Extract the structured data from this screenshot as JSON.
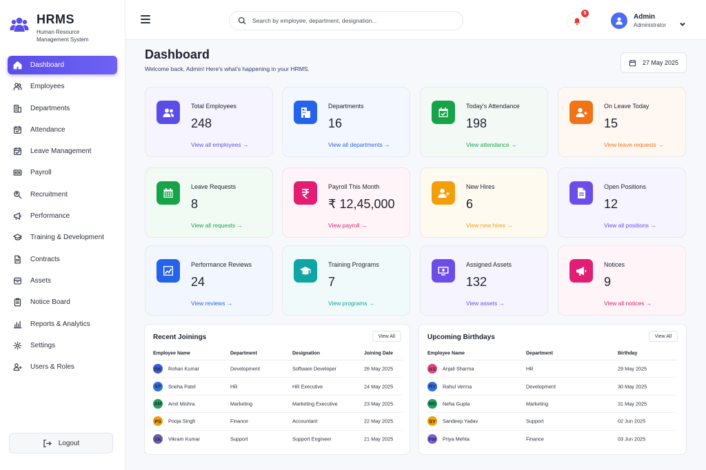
{
  "brand": {
    "title": "HRMS",
    "subtitle": "Human Resource Management System"
  },
  "nav": [
    {
      "label": "Dashboard",
      "icon": "home-icon",
      "active": true
    },
    {
      "label": "Employees",
      "icon": "users-icon"
    },
    {
      "label": "Departments",
      "icon": "building-icon"
    },
    {
      "label": "Attendance",
      "icon": "calendar-check-icon"
    },
    {
      "label": "Leave Management",
      "icon": "calendar-leave-icon"
    },
    {
      "label": "Payroll",
      "icon": "money-icon"
    },
    {
      "label": "Recruitment",
      "icon": "search-person-icon"
    },
    {
      "label": "Performance",
      "icon": "megaphone-icon"
    },
    {
      "label": "Training & Development",
      "icon": "graduation-cap-icon"
    },
    {
      "label": "Contracts",
      "icon": "document-icon"
    },
    {
      "label": "Assets",
      "icon": "box-icon"
    },
    {
      "label": "Notice Board",
      "icon": "clipboard-icon"
    },
    {
      "label": "Reports & Analytics",
      "icon": "bar-chart-icon"
    },
    {
      "label": "Settings",
      "icon": "gear-icon"
    },
    {
      "label": "Users & Roles",
      "icon": "user-roles-icon"
    }
  ],
  "logout": {
    "label": "Logout"
  },
  "topbar": {
    "search_placeholder": "Search by employee, department, designation...",
    "notification_count": "5",
    "user_name": "Admin",
    "user_role": "Administrator"
  },
  "header": {
    "title": "Dashboard",
    "welcome": "Welcome back, Admin! Here's what's happening in your HRMS.",
    "date": "27 May 2025"
  },
  "cards": [
    {
      "title": "Total Employees",
      "value": "248",
      "link": "View all employees →",
      "icon": "users-icon",
      "color": "#5b4ee8",
      "bg": "#f6f5ff"
    },
    {
      "title": "Departments",
      "value": "16",
      "link": "View all departments →",
      "icon": "building-icon",
      "color": "#2563eb",
      "bg": "#f3f7ff"
    },
    {
      "title": "Today's Attendance",
      "value": "198",
      "link": "View attendance →",
      "icon": "calendar-check-icon",
      "color": "#16a34a",
      "bg": "#f3faf5"
    },
    {
      "title": "On Leave Today",
      "value": "15",
      "link": "View leave requests →",
      "icon": "user-plus-icon",
      "color": "#f07415",
      "bg": "#fff8f2"
    },
    {
      "title": "Leave Requests",
      "value": "8",
      "link": "View all requests →",
      "icon": "calendar-grid-icon",
      "color": "#16a34a",
      "bg": "#f2faf4"
    },
    {
      "title": "Payroll This Month",
      "value": "₹ 12,45,000",
      "link": "View payroll →",
      "icon": "rupee-icon",
      "color": "#e11d74",
      "bg": "#fff4f7"
    },
    {
      "title": "New Hires",
      "value": "6",
      "link": "View new hires →",
      "icon": "user-plus-icon",
      "color": "#f59e0b",
      "bg": "#fffaf0"
    },
    {
      "title": "Open Positions",
      "value": "12",
      "link": "View all positions →",
      "icon": "document-icon",
      "color": "#6d4de8",
      "bg": "#f6f4ff"
    },
    {
      "title": "Performance Reviews",
      "value": "24",
      "link": "View reviews →",
      "icon": "trend-chart-icon",
      "color": "#2563eb",
      "bg": "#f2f6ff"
    },
    {
      "title": "Training Programs",
      "value": "7",
      "link": "View programs →",
      "icon": "graduation-cap-icon",
      "color": "#0ea5a4",
      "bg": "#f1fafa"
    },
    {
      "title": "Assigned Assets",
      "value": "132",
      "link": "View assets →",
      "icon": "monitor-icon",
      "color": "#6d4de8",
      "bg": "#f6f4ff"
    },
    {
      "title": "Notices",
      "value": "9",
      "link": "View all notices →",
      "icon": "megaphone-icon",
      "color": "#e11d74",
      "bg": "#fff4f7"
    }
  ],
  "recent_joinings": {
    "title": "Recent Joinings",
    "view_all": "View All",
    "columns": [
      "Employee Name",
      "Department",
      "Designation",
      "Joining Date"
    ],
    "rows": [
      {
        "initials": "RK",
        "color": "#3b5bdb",
        "name": "Rohan Kumar",
        "department": "Development",
        "designation": "Software Developer",
        "date": "26 May 2025"
      },
      {
        "initials": "SP",
        "color": "#2f6fe4",
        "name": "Sneha Patel",
        "department": "HR",
        "designation": "HR Executive",
        "date": "24 May 2025"
      },
      {
        "initials": "AM",
        "color": "#22a05b",
        "name": "Amit Mishra",
        "department": "Marketing",
        "designation": "Marketing Executive",
        "date": "23 May 2025"
      },
      {
        "initials": "PS",
        "color": "#f59e0b",
        "name": "Pooja Singh",
        "department": "Finance",
        "designation": "Accountant",
        "date": "22 May 2025"
      },
      {
        "initials": "VK",
        "color": "#6b5bb5",
        "name": "Vikram Kumar",
        "department": "Support",
        "designation": "Support Engineer",
        "date": "21 May 2025"
      }
    ]
  },
  "birthdays": {
    "title": "Upcoming Birthdays",
    "view_all": "View All",
    "columns": [
      "Employee Name",
      "Department",
      "Birthday"
    ],
    "rows": [
      {
        "initials": "AS",
        "color": "#e0457b",
        "name": "Anjali Sharma",
        "department": "HR",
        "date": "29 May 2025"
      },
      {
        "initials": "RV",
        "color": "#2f6fe4",
        "name": "Rahul Verma",
        "department": "Development",
        "date": "30 May 2025"
      },
      {
        "initials": "NG",
        "color": "#22a05b",
        "name": "Neha Gupta",
        "department": "Marketing",
        "date": "31 May 2025"
      },
      {
        "initials": "SY",
        "color": "#f59e0b",
        "name": "Sandeep Yadav",
        "department": "Support",
        "date": "02 Jun 2025"
      },
      {
        "initials": "PM",
        "color": "#7c5ce0",
        "name": "Priya Mehta",
        "department": "Finance",
        "date": "03 Jun 2025"
      }
    ]
  }
}
